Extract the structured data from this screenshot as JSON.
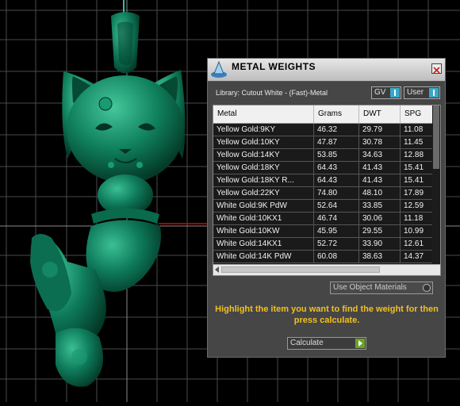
{
  "panel": {
    "title": "METAL WEIGHTS",
    "library_label": "Library: Cutout White - (Fast)-Metal",
    "toggles": [
      {
        "label": "GV"
      },
      {
        "label": "User"
      }
    ],
    "use_object_materials": "Use Object Materials",
    "instruction": "Highlight the item you want to find the weight for then press calculate.",
    "calculate_label": "Calculate"
  },
  "table": {
    "columns": [
      "Metal",
      "Grams",
      "DWT",
      "SPG"
    ],
    "rows": [
      [
        "Yellow Gold:9KY",
        "46.32",
        "29.79",
        "11.08"
      ],
      [
        "Yellow Gold:10KY",
        "47.87",
        "30.78",
        "11.45"
      ],
      [
        "Yellow Gold:14KY",
        "53.85",
        "34.63",
        "12.88"
      ],
      [
        "Yellow Gold:18KY",
        "64.43",
        "41.43",
        "15.41"
      ],
      [
        "Yellow Gold:18KY R...",
        "64.43",
        "41.43",
        "15.41"
      ],
      [
        "Yellow Gold:22KY",
        "74.80",
        "48.10",
        "17.89"
      ],
      [
        "White Gold:9K PdW",
        "52.64",
        "33.85",
        "12.59"
      ],
      [
        "White Gold:10KX1",
        "46.74",
        "30.06",
        "11.18"
      ],
      [
        "White Gold:10KW",
        "45.95",
        "29.55",
        "10.99"
      ],
      [
        "White Gold:14KX1",
        "52.72",
        "33.90",
        "12.61"
      ],
      [
        "White Gold:14K PdW",
        "60.08",
        "38.63",
        "14.37"
      ]
    ]
  },
  "colors": {
    "viewport_bg": "#000000",
    "model_green": "#0e7a5a",
    "instruction_text": "#f0c020",
    "title_bar": "#d8d8d8"
  }
}
